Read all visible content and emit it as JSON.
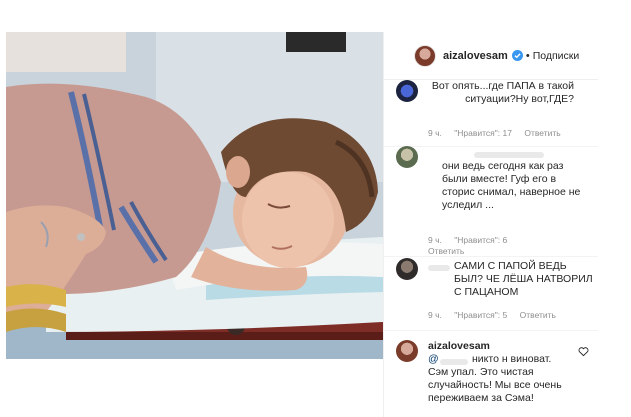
{
  "post": {
    "username": "aizalovesam",
    "separator": "•",
    "follow_label": "Подписки"
  },
  "comments": [
    {
      "text": "Вот опять...где ПАПА в такой ситуации?Ну вот,ГДЕ?",
      "time": "9 ч.",
      "likes": "\"Нравится\": 17",
      "reply": "Ответить"
    },
    {
      "text": "они ведь сегодня как раз были вместе! Гуф его в сторис снимал, наверное не уследил ...",
      "time": "9 ч.",
      "likes": "\"Нравится\": 6",
      "reply": "Ответить"
    },
    {
      "text": "САМИ С ПАПОЙ ВЕДЬ БЫЛ? ЧЕ ЛЁША НАТВОРИЛ С ПАЦАНОМ",
      "time": "9 ч.",
      "likes": "\"Нравится\": 5",
      "reply": "Ответить"
    },
    {
      "author": "aizalovesam",
      "mention": "@",
      "text": "никто н виноват. Сэм упал. Это чистая случайность! Мы все очень переживаем за Сэма!"
    }
  ],
  "colors": {
    "verified": "#3897f0",
    "meta": "#8e8e8e",
    "text": "#262626"
  },
  "icons": {
    "verified": "verified-badge-icon",
    "heart": "heart-icon"
  }
}
